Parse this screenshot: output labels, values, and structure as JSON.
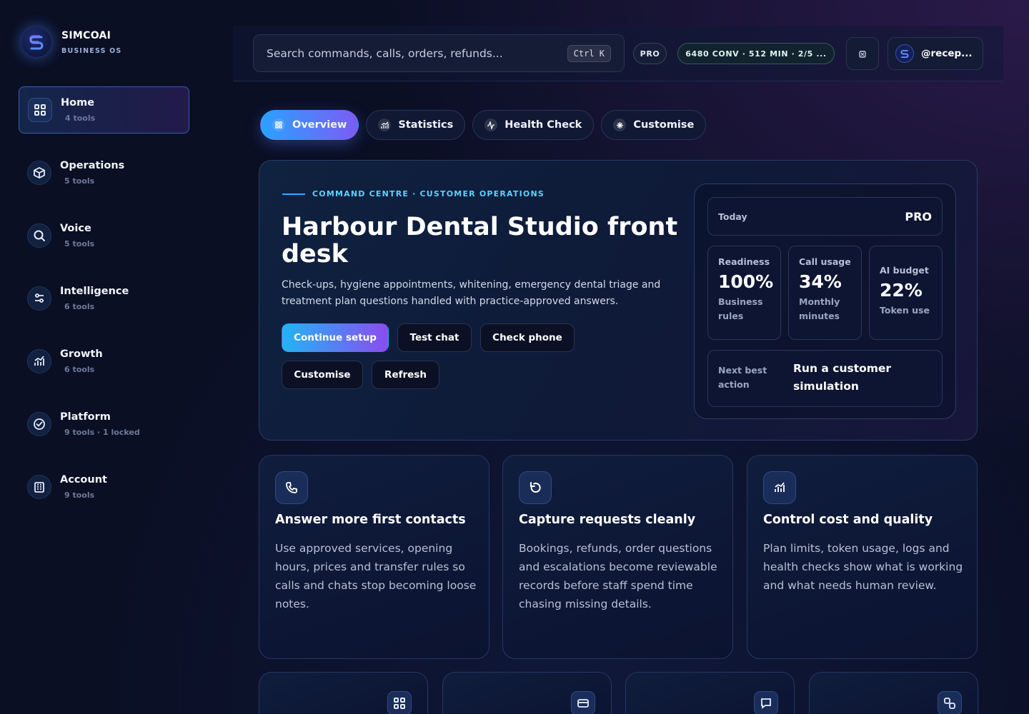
{
  "brand": {
    "name": "SIMCOAI",
    "subtitle": "BUSINESS OS"
  },
  "sidebar": {
    "items": [
      {
        "label": "Home",
        "sub": "4 tools",
        "icon": "grid-icon",
        "active": true
      },
      {
        "label": "Operations",
        "sub": "5 tools",
        "icon": "box-icon"
      },
      {
        "label": "Voice",
        "sub": "5 tools",
        "icon": "search-icon"
      },
      {
        "label": "Intelligence",
        "sub": "6 tools",
        "icon": "sliders-icon"
      },
      {
        "label": "Growth",
        "sub": "6 tools",
        "icon": "chart-icon"
      },
      {
        "label": "Platform",
        "sub": "9 tools · 1 locked",
        "icon": "check-circle-icon"
      },
      {
        "label": "Account",
        "sub": "9 tools",
        "icon": "building-icon"
      }
    ]
  },
  "topbar": {
    "search_placeholder": "Search commands, calls, orders, refunds...",
    "shortcut": "Ctrl K",
    "plan": "PRO",
    "usage": "6480 CONV · 512 MIN · 2/5 ...",
    "user": "@recep..."
  },
  "tabs": [
    {
      "label": "Overview",
      "active": true
    },
    {
      "label": "Statistics"
    },
    {
      "label": "Health Check"
    },
    {
      "label": "Customise"
    }
  ],
  "hero": {
    "eyebrow": "COMMAND CENTRE · CUSTOMER OPERATIONS",
    "title": "Harbour Dental Studio front desk",
    "description": "Check-ups, hygiene appointments, whitening, emergency dental triage and treatment plan questions handled with practice-approved answers.",
    "buttons": {
      "continue": "Continue setup",
      "test_chat": "Test chat",
      "check_phone": "Check phone",
      "customise": "Customise",
      "refresh": "Refresh"
    }
  },
  "stats": {
    "today_label": "Today",
    "plan": "PRO",
    "cards": [
      {
        "title": "Readiness",
        "value": "100%",
        "sub": "Business rules"
      },
      {
        "title": "Call usage",
        "value": "34%",
        "sub": "Monthly minutes"
      },
      {
        "title": "AI budget",
        "value": "22%",
        "sub": "Token use"
      }
    ],
    "next_label": "Next best action",
    "next_action": "Run a customer simulation"
  },
  "features": [
    {
      "icon": "phone-icon",
      "title": "Answer more first contacts",
      "desc": "Use approved services, opening hours, prices and transfer rules so calls and chats stop becoming loose notes."
    },
    {
      "icon": "refresh-icon",
      "title": "Capture requests cleanly",
      "desc": "Bookings, refunds, order questions and escalations become reviewable records before staff spend time chasing missing details."
    },
    {
      "icon": "chart-icon",
      "title": "Control cost and quality",
      "desc": "Plan limits, token usage, logs and health checks show what is working and what needs human review."
    }
  ],
  "mini_cards": [
    {
      "icon": "grid-icon"
    },
    {
      "icon": "card-icon"
    },
    {
      "icon": "chat-icon"
    },
    {
      "icon": "link-icon"
    }
  ],
  "colors": {
    "accent_start": "#22b4f5",
    "accent_end": "#8a4cf0",
    "eyebrow": "#5fd0ff",
    "background": "#0a0f24"
  }
}
